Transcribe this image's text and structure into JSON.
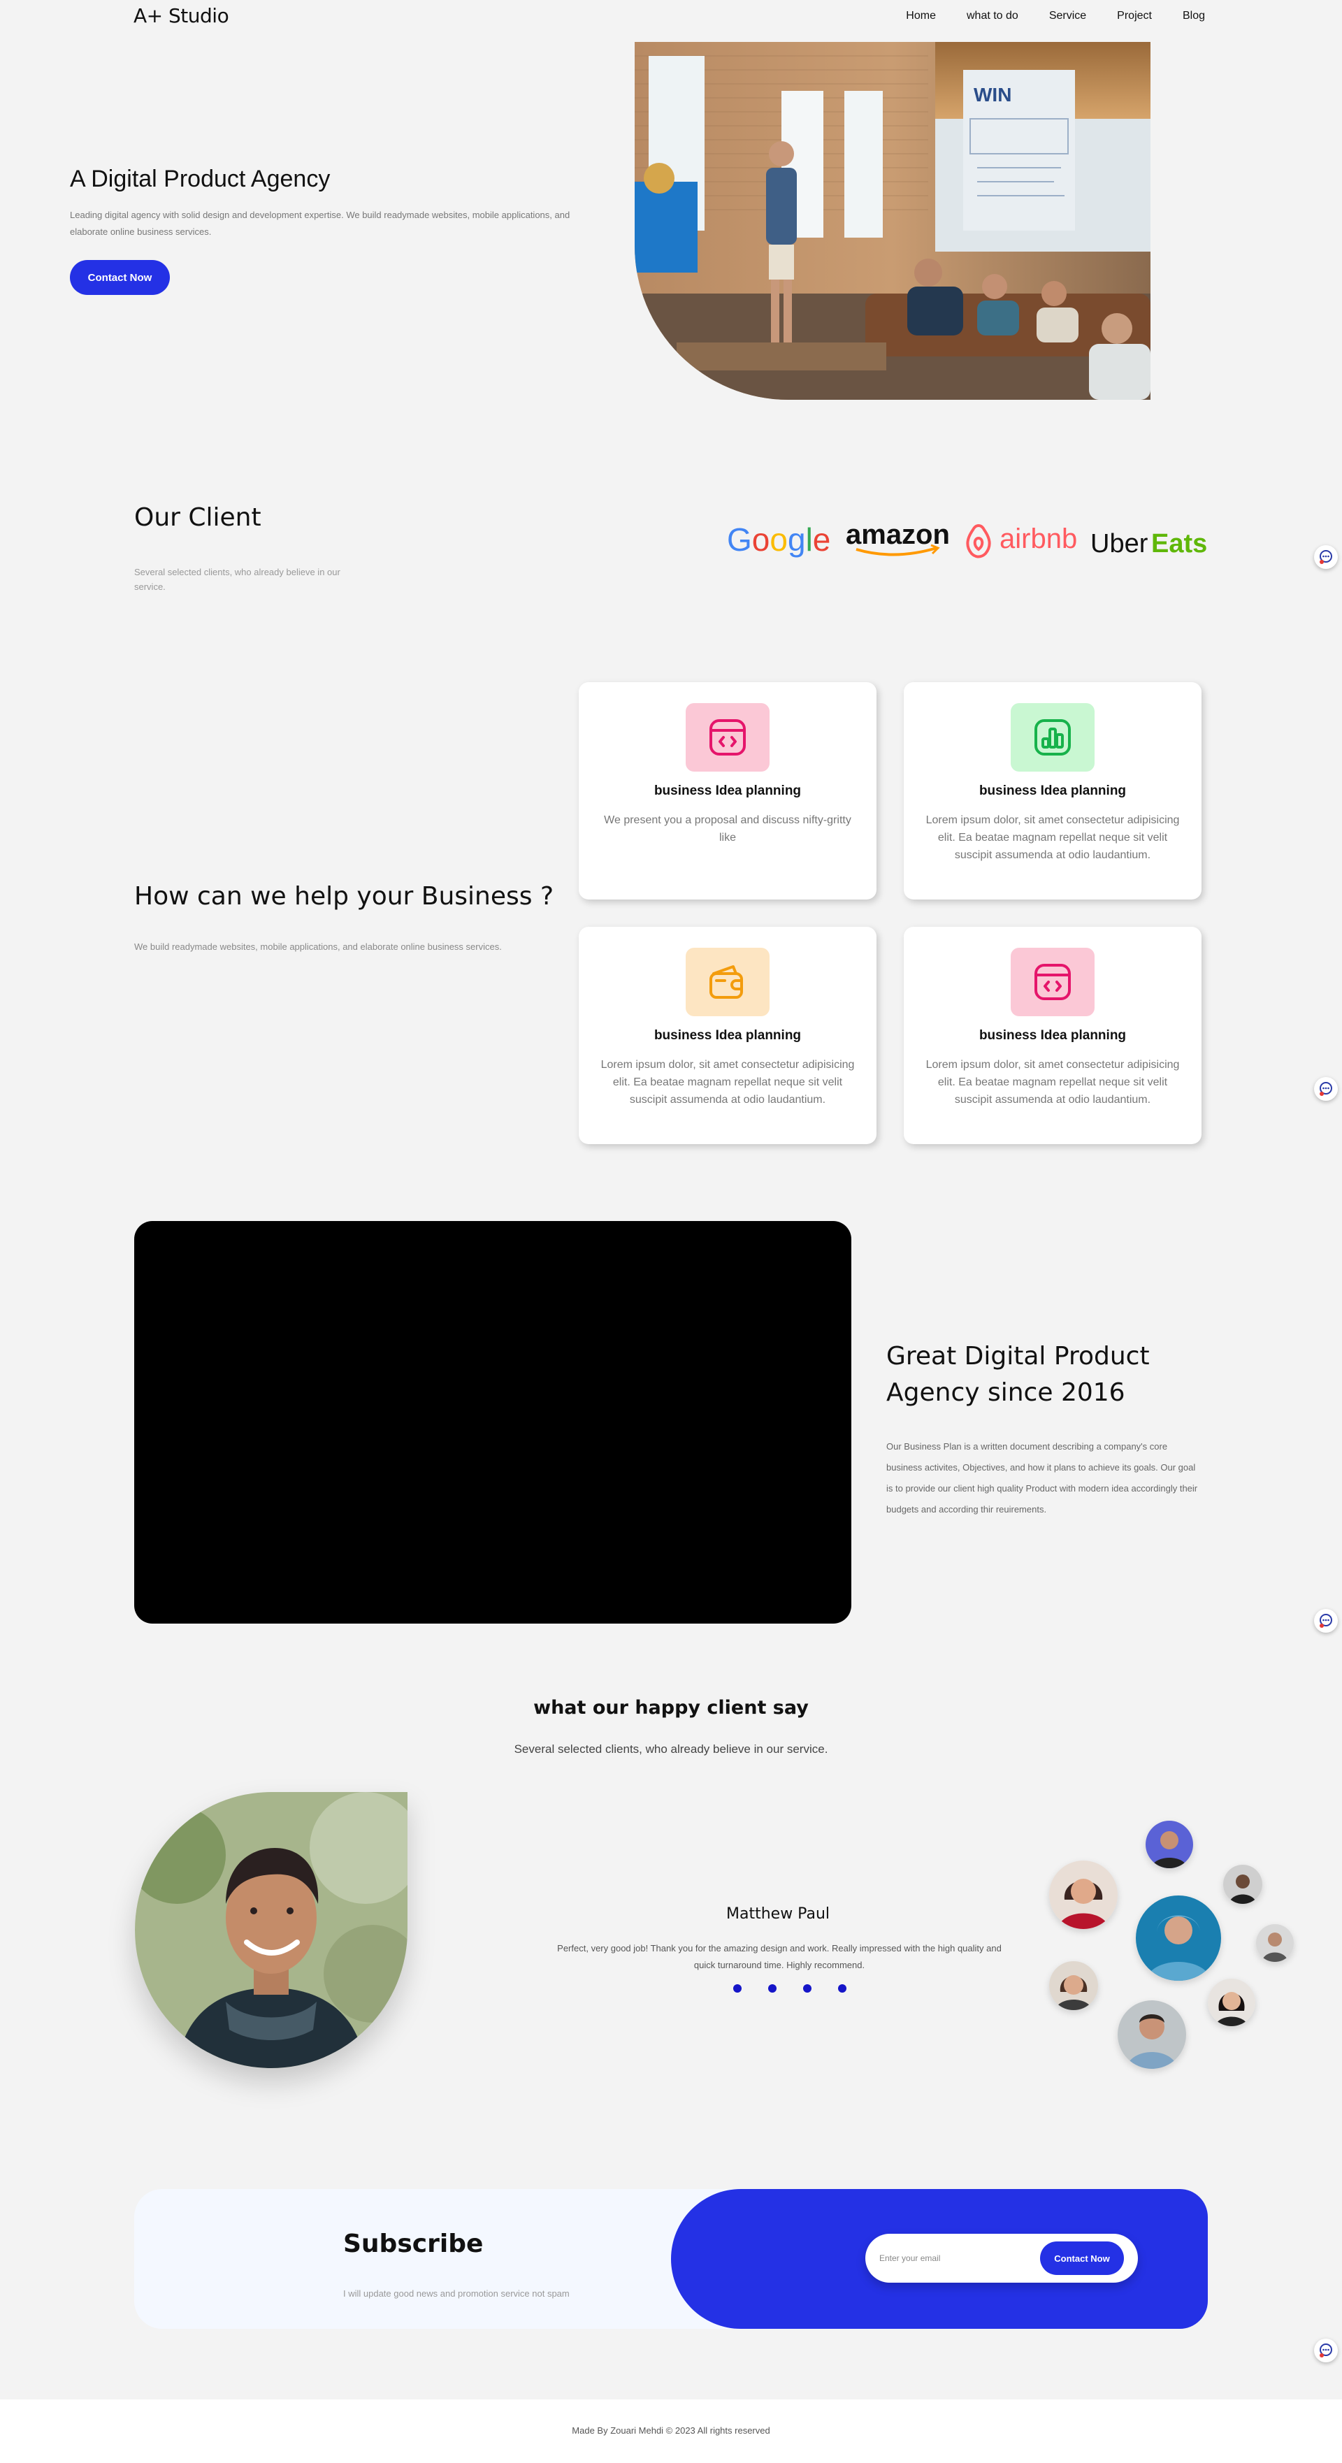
{
  "nav": {
    "logo": "A+ Studio",
    "links": [
      "Home",
      "what to do",
      "Service",
      "Project",
      "Blog"
    ]
  },
  "hero": {
    "title": "A Digital Product Agency",
    "description": "Leading digital agency with solid design and development expertise. We build readymade websites, mobile applications, and elaborate online business services.",
    "button": "Contact Now",
    "image_sign": "WIN"
  },
  "clients": {
    "title": "Our Client",
    "subtitle": "Several selected clients, who already believe in our service.",
    "brands": [
      "Google",
      "amazon",
      "airbnb",
      "Uber",
      "Eats"
    ]
  },
  "help": {
    "title": "How can we help your Business ?",
    "subtitle": "We build readymade websites, mobile applications, and elaborate online business services.",
    "cards": [
      {
        "title": "business Idea planning",
        "text": "We present you a proposal and discuss nifty-gritty like",
        "icon": "code-window-icon",
        "color": "#fbc8d6"
      },
      {
        "title": "business Idea planning",
        "text": "Lorem ipsum dolor, sit amet consectetur adipisicing elit. Ea beatae magnam repellat neque sit velit suscipit assumenda at odio laudantium.",
        "icon": "bar-chart-icon",
        "color": "#c9f7d2"
      },
      {
        "title": "business Idea planning",
        "text": "Lorem ipsum dolor, sit amet consectetur adipisicing elit. Ea beatae magnam repellat neque sit velit suscipit assumenda at odio laudantium.",
        "icon": "wallet-icon",
        "color": "#fde5c2"
      },
      {
        "title": "business Idea planning",
        "text": "Lorem ipsum dolor, sit amet consectetur adipisicing elit. Ea beatae magnam repellat neque sit velit suscipit assumenda at odio laudantium.",
        "icon": "code-window-icon",
        "color": "#fbc8d6"
      }
    ]
  },
  "agency": {
    "title": "Great Digital Product Agency since 2016",
    "description": "Our Business Plan is a written document describing a company's core business activites, Objectives, and how it plans to achieve its goals. Our goal is to provide our client high quality Product with modern idea accordingly their budgets and according thir reuirements."
  },
  "testimonials": {
    "title": "what our happy client say",
    "subtitle": "Several selected clients, who already believe in our service.",
    "name": "Matthew Paul",
    "text": "Perfect, very good job! Thank you for the amazing design and work. Really impressed with the high quality and quick turnaround time. Highly recommend.",
    "dots": 4
  },
  "subscribe": {
    "title": "Subscribe",
    "subtitle": "I will update good news and promotion service not spam",
    "placeholder": "Enter your email",
    "button": "Contact Now"
  },
  "footer": {
    "text": "Made By Zouari Mehdi © 2023 All rights reserved"
  },
  "colors": {
    "accent": "#2431e5",
    "background": "#f3f3f3"
  }
}
